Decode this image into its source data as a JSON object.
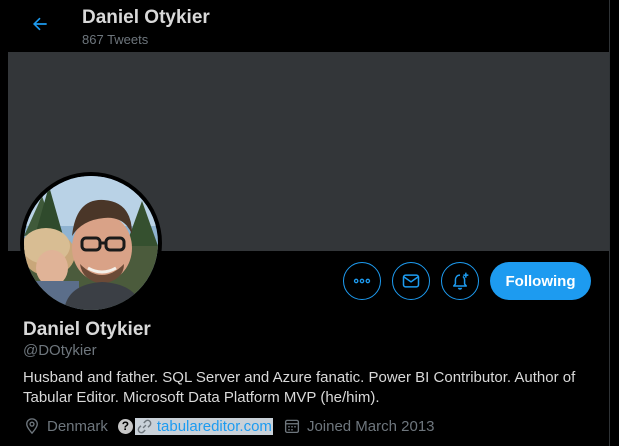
{
  "header": {
    "title": "Daniel Otykier",
    "tweet_count": "867 Tweets"
  },
  "profile": {
    "name": "Daniel Otykier",
    "handle": "@DOtykier",
    "bio": "Husband and father. SQL Server and Azure fanatic. Power BI Contributor. Author of Tabular Editor. Microsoft Data Platform MVP (he/him).",
    "location": "Denmark",
    "website": "tabulareditor.com",
    "joined": "Joined March 2013"
  },
  "actions": {
    "follow_label": "Following",
    "icons": [
      "more-icon",
      "message-icon",
      "notification-bell-plus-icon"
    ]
  },
  "colors": {
    "background": "#000000",
    "banner": "#333639",
    "accent": "#1d9bf0",
    "text_primary": "#d9d9d9",
    "text_secondary": "#6e767d"
  }
}
